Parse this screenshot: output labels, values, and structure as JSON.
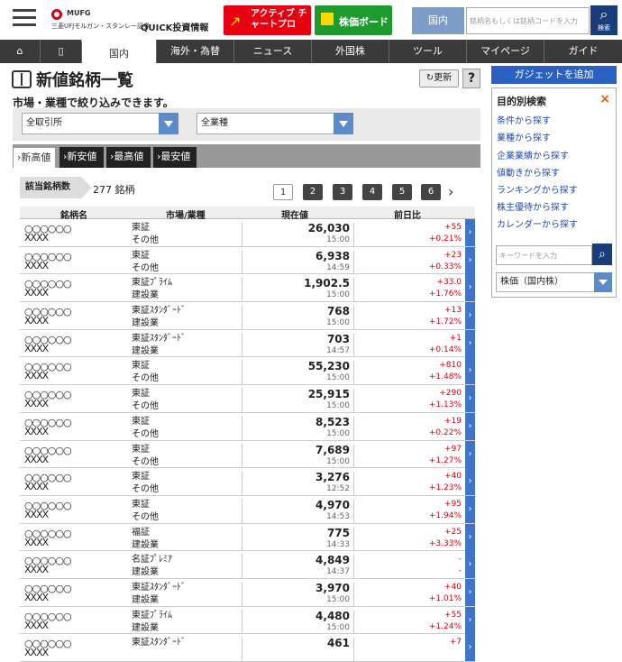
{
  "header": {
    "logo_brand": "MUFG",
    "logo_sub": "三菱UFJモルガン・スタンレー証券",
    "logo_product": "QUICK投資情報",
    "active_chart_label": "アクティブ チャートプロ",
    "board_label": "株価ボード",
    "region_label": "国内",
    "search_placeholder": "銘柄名もしくは銘柄コードを入力",
    "search_btn_label": "検索"
  },
  "nav": {
    "home_icon": "home-icon",
    "book_icon": "book-icon",
    "items": [
      "国内",
      "海外・為替",
      "ニュース",
      "外国株",
      "ツール",
      "マイページ",
      "ガイド"
    ]
  },
  "page": {
    "title": "新値銘柄一覧",
    "refresh_label": "更新",
    "help_label": "?",
    "subtitle": "市場・業種で絞り込みできます。"
  },
  "filters": {
    "market": "全取引所",
    "sector": "全業種"
  },
  "tabs": [
    "新高値",
    "新安値",
    "最高値",
    "最安値"
  ],
  "count": {
    "label": "該当銘柄数",
    "value": "277 銘柄"
  },
  "pagination": [
    "1",
    "2",
    "3",
    "4",
    "5",
    "6"
  ],
  "table": {
    "headers": [
      "銘柄名",
      "市場/業種",
      "現在値",
      "前日比"
    ],
    "rows": [
      {
        "name": "○○○○○○",
        "code": "XXXX",
        "market": "東証",
        "sector": "その他",
        "price": "26,030",
        "time": "15:00",
        "change": "+55",
        "pct": "+0.21%"
      },
      {
        "name": "○○○○○○",
        "code": "XXXX",
        "market": "東証",
        "sector": "その他",
        "price": "6,938",
        "time": "14:59",
        "change": "+23",
        "pct": "+0.33%"
      },
      {
        "name": "○○○○○○",
        "code": "XXXX",
        "market": "東証ﾌﾟﾗｲﾑ",
        "sector": "建設業",
        "price": "1,902.5",
        "time": "15:00",
        "change": "+33.0",
        "pct": "+1.76%"
      },
      {
        "name": "○○○○○○",
        "code": "XXXX",
        "market": "東証ｽﾀﾝﾀﾞｰﾄﾞ",
        "sector": "建設業",
        "price": "768",
        "time": "15:00",
        "change": "+13",
        "pct": "+1.72%"
      },
      {
        "name": "○○○○○○",
        "code": "XXXX",
        "market": "東証ｽﾀﾝﾀﾞｰﾄﾞ",
        "sector": "建設業",
        "price": "703",
        "time": "14:57",
        "change": "+1",
        "pct": "+0.14%"
      },
      {
        "name": "○○○○○○",
        "code": "XXXX",
        "market": "東証",
        "sector": "その他",
        "price": "55,230",
        "time": "15:00",
        "change": "+810",
        "pct": "+1.48%"
      },
      {
        "name": "○○○○○○",
        "code": "XXXX",
        "market": "東証",
        "sector": "その他",
        "price": "25,915",
        "time": "15:00",
        "change": "+290",
        "pct": "+1.13%"
      },
      {
        "name": "○○○○○○",
        "code": "XXXX",
        "market": "東証",
        "sector": "その他",
        "price": "8,523",
        "time": "15:00",
        "change": "+19",
        "pct": "+0.22%"
      },
      {
        "name": "○○○○○○",
        "code": "XXXX",
        "market": "東証",
        "sector": "その他",
        "price": "7,689",
        "time": "15:00",
        "change": "+97",
        "pct": "+1.27%"
      },
      {
        "name": "○○○○○○",
        "code": "XXXX",
        "market": "東証",
        "sector": "その他",
        "price": "3,276",
        "time": "12:52",
        "change": "+40",
        "pct": "+1.23%"
      },
      {
        "name": "○○○○○○",
        "code": "XXXX",
        "market": "東証",
        "sector": "その他",
        "price": "4,970",
        "time": "14:53",
        "change": "+95",
        "pct": "+1.94%"
      },
      {
        "name": "○○○○○○",
        "code": "XXXX",
        "market": "福証",
        "sector": "建設業",
        "price": "775",
        "time": "14:33",
        "change": "+25",
        "pct": "+3.33%"
      },
      {
        "name": "○○○○○○",
        "code": "XXXX",
        "market": "名証ﾌﾟﾚﾐｱ",
        "sector": "建設業",
        "price": "4,849",
        "time": "14:37",
        "change": "-",
        "pct": "-"
      },
      {
        "name": "○○○○○○",
        "code": "XXXX",
        "market": "東証ｽﾀﾝﾀﾞｰﾄﾞ",
        "sector": "建設業",
        "price": "3,970",
        "time": "15:00",
        "change": "+40",
        "pct": "+1.01%"
      },
      {
        "name": "○○○○○○",
        "code": "XXXX",
        "market": "東証ﾌﾟﾗｲﾑ",
        "sector": "建設業",
        "price": "4,480",
        "time": "15:00",
        "change": "+55",
        "pct": "+1.24%"
      },
      {
        "name": "○○○○○○",
        "code": "XXXX",
        "market": "東証ｽﾀﾝﾀﾞｰﾄﾞ",
        "sector": "",
        "price": "461",
        "time": "",
        "change": "+7",
        "pct": ""
      }
    ]
  },
  "side": {
    "gadget_label": "ガジェットを追加",
    "title": "目的別検索",
    "close_label": "×",
    "links": [
      "条件から探す",
      "業種から探す",
      "企業業績から探す",
      "値動きから探す",
      "ランキングから探す",
      "株主優待から探す",
      "カレンダーから探す"
    ],
    "search_placeholder": "キーワードを入力",
    "select_value": "株価（国内株）"
  },
  "colors": {
    "accent_blue": "#2a61c3",
    "up_red": "#e0000e",
    "nav_dark": "#3a3a3a"
  }
}
